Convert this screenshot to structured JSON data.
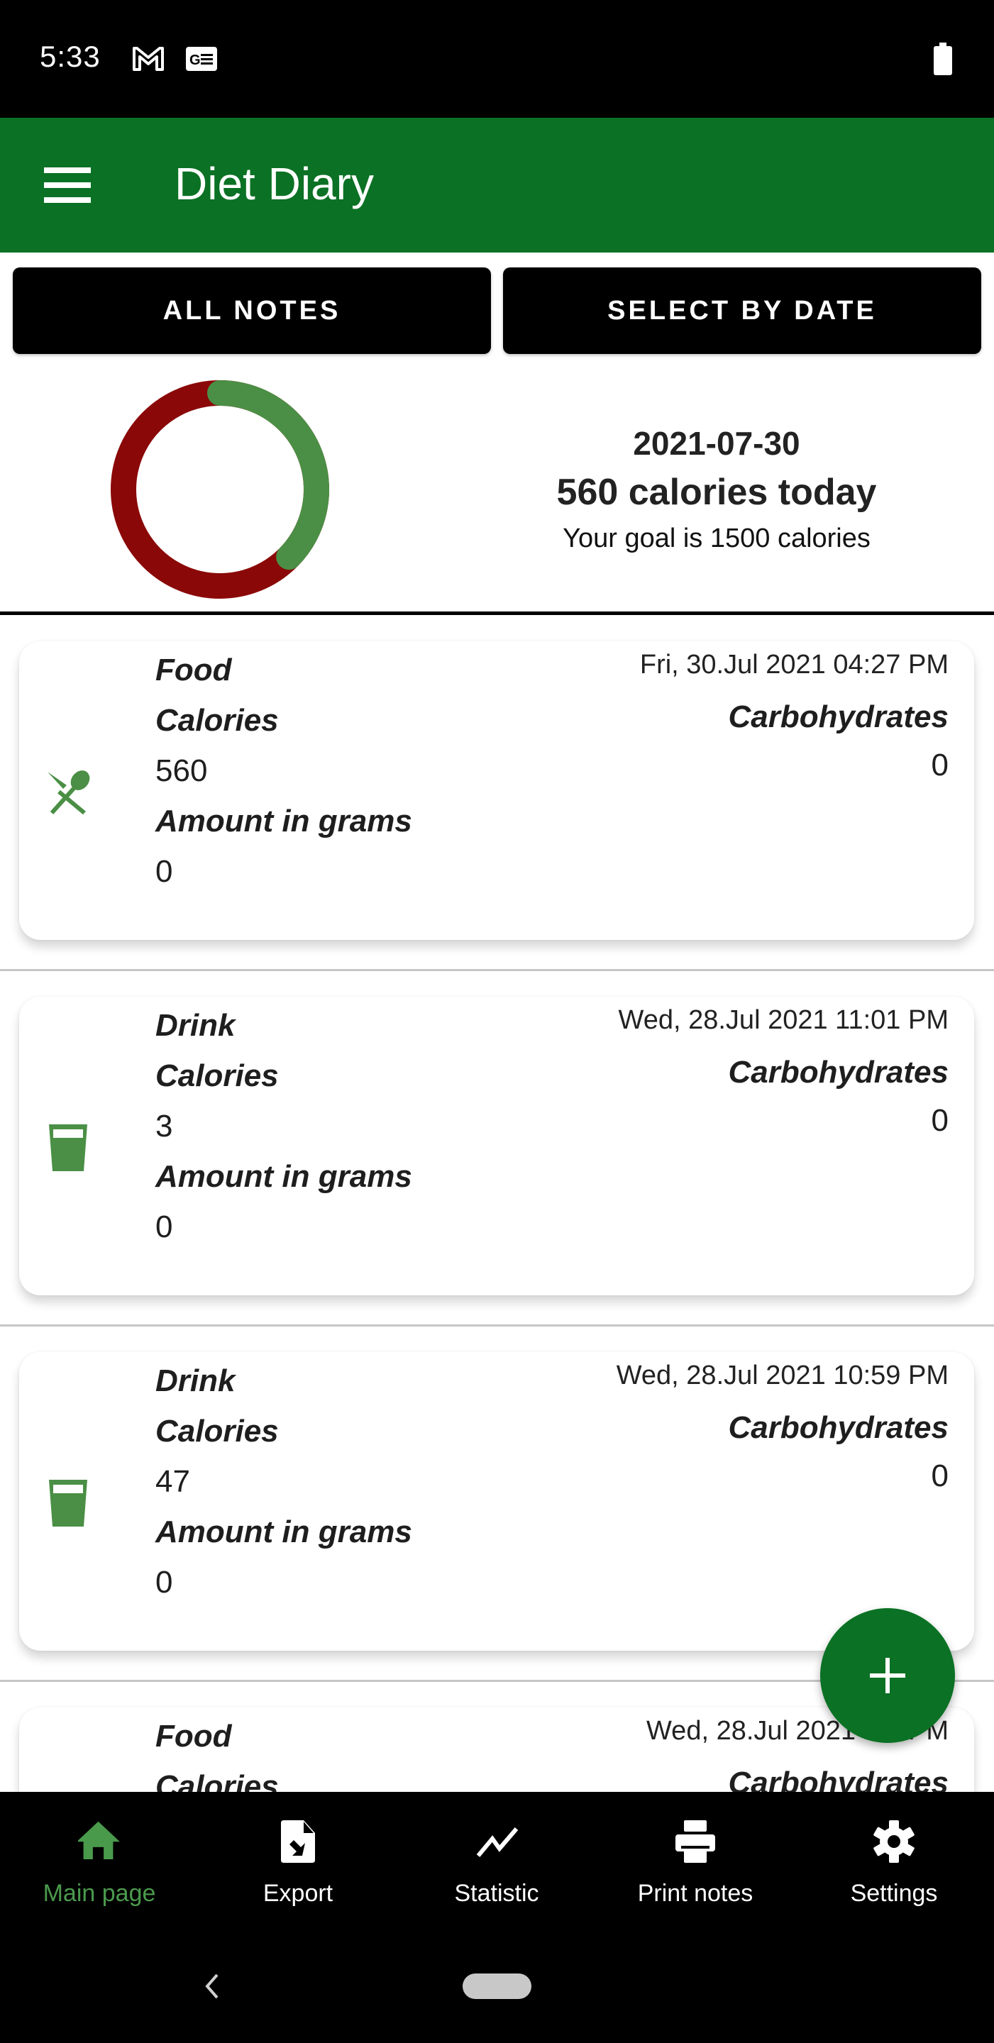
{
  "status_bar": {
    "time": "5:33",
    "icons": [
      "gmail-icon",
      "news-icon",
      "battery-icon"
    ]
  },
  "app_bar": {
    "title": "Diet Diary",
    "menu_icon": "hamburger-menu-icon"
  },
  "filters": {
    "all_notes_label": "ALL NOTES",
    "select_by_date_label": "SELECT BY DATE"
  },
  "summary": {
    "date": "2021-07-30",
    "calories_text": "560 calories today",
    "goal_text": "Your goal is 1500 calories",
    "calories_consumed": 560,
    "calories_goal": 1500,
    "progress_fraction": 0.373,
    "colors": {
      "consumed": "#4a8f45",
      "remaining": "#8b0808"
    }
  },
  "labels": {
    "calories": "Calories",
    "amount": "Amount in grams",
    "carbohydrates": "Carbohydrates"
  },
  "notes": [
    {
      "type": "Food",
      "icon": "restaurant-icon",
      "datetime": "Fri, 30.Jul 2021 04:27 PM",
      "calories": "560",
      "amount": "0",
      "carbohydrates": "0"
    },
    {
      "type": "Drink",
      "icon": "drink-glass-icon",
      "datetime": "Wed, 28.Jul 2021 11:01 PM",
      "calories": "3",
      "amount": "0",
      "carbohydrates": "0"
    },
    {
      "type": "Drink",
      "icon": "drink-glass-icon",
      "datetime": "Wed, 28.Jul 2021 10:59 PM",
      "calories": "47",
      "amount": "0",
      "carbohydrates": "0"
    },
    {
      "type": "Food",
      "icon": "restaurant-icon",
      "datetime": "Wed, 28.Jul 2021 10:   PM",
      "calories": "",
      "amount": "",
      "carbohydrates": ""
    }
  ],
  "fab": {
    "icon": "plus-icon",
    "color": "#0b7124"
  },
  "bottom_nav": {
    "items": [
      {
        "label": "Main page",
        "icon": "home-icon",
        "active": true
      },
      {
        "label": "Export",
        "icon": "export-file-icon",
        "active": false
      },
      {
        "label": "Statistic",
        "icon": "trending-line-icon",
        "active": false
      },
      {
        "label": "Print notes",
        "icon": "printer-icon",
        "active": false
      },
      {
        "label": "Settings",
        "icon": "gear-icon",
        "active": false
      }
    ],
    "active_color": "#4a9a4c"
  },
  "theme": {
    "primary": "#0b7124",
    "icon_green": "#4a8f45"
  }
}
